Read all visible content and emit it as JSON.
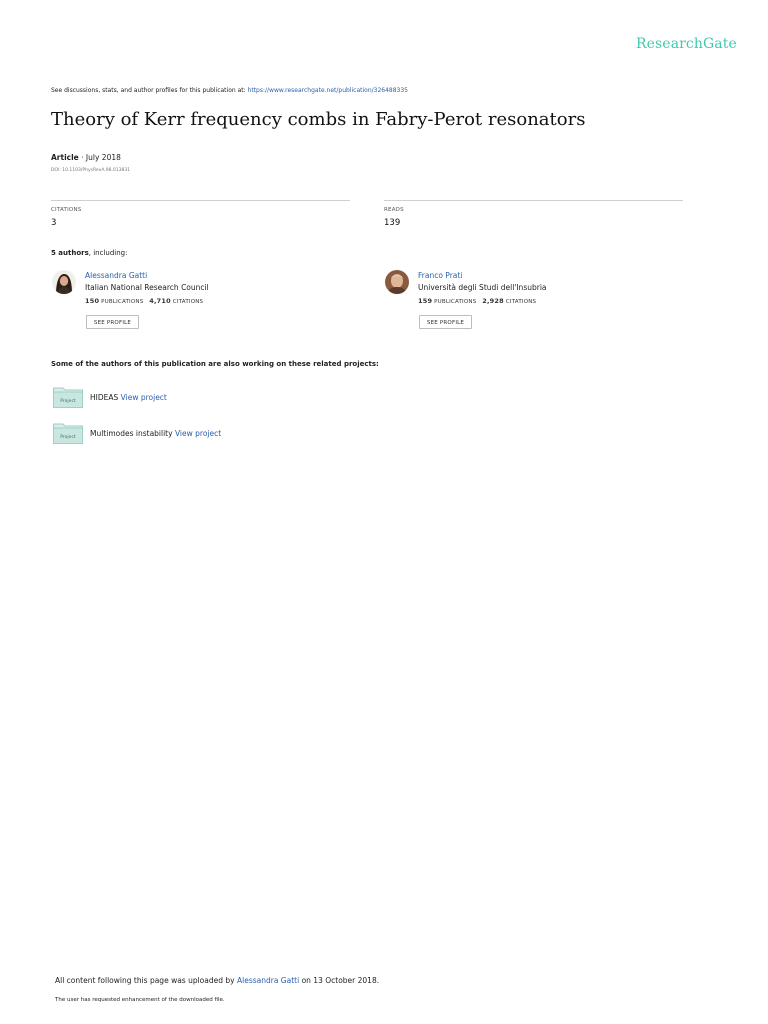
{
  "logo": "ResearchGate",
  "disclaimer": {
    "prefix": "See discussions, stats, and author profiles for this publication at: ",
    "url": "https://www.researchgate.net/publication/326488335"
  },
  "title": "Theory of Kerr frequency combs in Fabry-Perot resonators",
  "meta": {
    "type": "Article",
    "separator": " · ",
    "date": "July 2018",
    "doi": "DOI: 10.1103/PhysRevA.98.013831"
  },
  "stats": {
    "citations_label": "CITATIONS",
    "citations_value": "3",
    "reads_label": "READS",
    "reads_value": "139"
  },
  "authors": {
    "count_label": "5 authors",
    "suffix": ", including:",
    "list": [
      {
        "name": "Alessandra Gatti",
        "institution": "Italian National Research Council",
        "publications": "150",
        "publications_label": "PUBLICATIONS",
        "citations": "4,710",
        "citations_label": "CITATIONS",
        "button": "SEE PROFILE"
      },
      {
        "name": "Franco Prati",
        "institution": "Università degli Studi dell'Insubria",
        "publications": "159",
        "publications_label": "PUBLICATIONS",
        "citations": "2,928",
        "citations_label": "CITATIONS",
        "button": "SEE PROFILE"
      }
    ]
  },
  "related": {
    "heading": "Some of the authors of this publication are also working on these related projects:",
    "folder_label": "Project",
    "projects": [
      {
        "name": "HIDEAS",
        "link": "View project"
      },
      {
        "name": "Multimodes instability",
        "link": "View project"
      }
    ]
  },
  "footer": {
    "prefix": "All content following this page was uploaded by ",
    "uploader": "Alessandra Gatti",
    "suffix": " on 13 October 2018.",
    "note": "The user has requested enhancement of the downloaded file."
  },
  "colors": {
    "brand": "#40c8b0",
    "link": "#2a5fa8"
  }
}
